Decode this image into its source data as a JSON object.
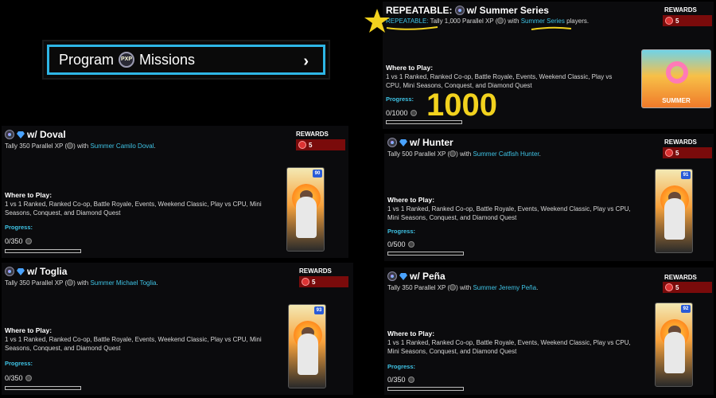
{
  "program_button": {
    "label_left": "Program",
    "icon_text": "PXP",
    "label_right": "Missions"
  },
  "annotation": {
    "number": "1000"
  },
  "rewards_label": "REWARDS",
  "where_heading": "Where to Play:",
  "where_text": "1 vs 1 Ranked, Ranked Co-op, Battle Royale, Events, Weekend Classic, Play vs CPU, Mini Seasons, Conquest, and Diamond Quest",
  "progress_label": "Progress:",
  "missions": {
    "summer": {
      "title_prefix": "REPEATABLE:",
      "title_suffix": "w/ Summer Series",
      "desc_a": "REPEATABLE:",
      "desc_b": " Tally 1,000 Parallel XP (",
      "desc_c": ") with ",
      "desc_link": "Summer Series",
      "desc_d": " players.",
      "reward": "5",
      "progress_text": "0/1000",
      "progress_fraction": 0,
      "card_label": "SUMMER"
    },
    "doval": {
      "title": "w/ Doval",
      "desc_a": "Tally 350 Parallel XP (",
      "desc_b": ") with ",
      "desc_link": "Summer Camilo Doval",
      "desc_c": ".",
      "reward": "5",
      "progress_text": "0/350",
      "progress_fraction": 0,
      "card_ovr": "90"
    },
    "hunter": {
      "title": "w/ Hunter",
      "desc_a": "Tally 500 Parallel XP (",
      "desc_b": ") with ",
      "desc_link": "Summer Catfish Hunter",
      "desc_c": ".",
      "reward": "5",
      "progress_text": "0/500",
      "progress_fraction": 0,
      "card_ovr": "91"
    },
    "toglia": {
      "title": "w/ Toglia",
      "desc_a": "Tally 350 Parallel XP (",
      "desc_b": ") with ",
      "desc_link": "Summer Michael Toglia",
      "desc_c": ".",
      "reward": "5",
      "progress_text": "0/350",
      "progress_fraction": 0,
      "card_ovr": "93"
    },
    "pena": {
      "title": "w/ Peña",
      "desc_a": "Tally 350 Parallel XP (",
      "desc_b": ") with ",
      "desc_link": "Summer Jeremy Peña",
      "desc_c": ".",
      "reward": "5",
      "progress_text": "0/350",
      "progress_fraction": 0,
      "card_ovr": "92"
    }
  },
  "colors": {
    "accent": "#3fc4e6",
    "reward_bg": "#7a0b0b",
    "highlight": "#f2d21e"
  }
}
